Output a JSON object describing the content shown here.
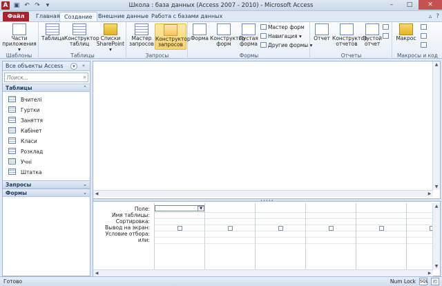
{
  "window": {
    "title": "Школа : база данных (Access 2007 - 2010)  -  Microsoft Access",
    "app_logo": "A",
    "qat": [
      "save-icon",
      "undo-icon",
      "redo-icon",
      "dropdown-icon"
    ],
    "controls": {
      "minimize": "–",
      "maximize": "□",
      "close": "✕"
    }
  },
  "tabs": {
    "file": "Файл",
    "items": [
      "Главная",
      "Создание",
      "Внешние данные",
      "Работа с базами данных"
    ],
    "active": "Создание",
    "right_icons": [
      "help-icon"
    ]
  },
  "ribbon": {
    "groups": [
      {
        "label": "Шаблоны",
        "buttons": [
          {
            "label": "Части приложения ▾"
          }
        ]
      },
      {
        "label": "Таблицы",
        "buttons": [
          {
            "label": "Таблица"
          },
          {
            "label": "Конструктор таблиц"
          },
          {
            "label": "Списки SharePoint ▾"
          }
        ]
      },
      {
        "label": "Запросы",
        "buttons": [
          {
            "label": "Мастер запросов"
          },
          {
            "label": "Конструктор запросов"
          }
        ]
      },
      {
        "label": "Формы",
        "buttons": [
          {
            "label": "Форма"
          },
          {
            "label": "Конструктор форм"
          },
          {
            "label": "Пустая форма"
          }
        ],
        "small": [
          "Мастер форм",
          "Навигация ▾",
          "Другие формы ▾"
        ]
      },
      {
        "label": "Отчеты",
        "buttons": [
          {
            "label": "Отчет"
          },
          {
            "label": "Конструктор отчетов"
          },
          {
            "label": "Пустой отчет"
          }
        ]
      },
      {
        "label": "Макросы и код",
        "buttons": [
          {
            "label": "Макрос"
          }
        ]
      }
    ]
  },
  "nav": {
    "title": "Все объекты Access",
    "search_placeholder": "Поиск...",
    "sections": [
      {
        "label": "Таблицы",
        "expanded": true,
        "items": [
          "Вчителі",
          "Гуртки",
          "Заняття",
          "Кабінет",
          "Класи",
          "Розклад",
          "Учні",
          "Штатка"
        ]
      },
      {
        "label": "Запросы",
        "expanded": false
      },
      {
        "label": "Формы",
        "expanded": false
      }
    ]
  },
  "qbe": {
    "row_labels": [
      "Поле:",
      "Имя таблицы:",
      "Сортировка:",
      "Вывод на экран:",
      "Условие отбора:",
      "или:"
    ]
  },
  "status": {
    "left": "Готово",
    "right": "Num Lock"
  }
}
